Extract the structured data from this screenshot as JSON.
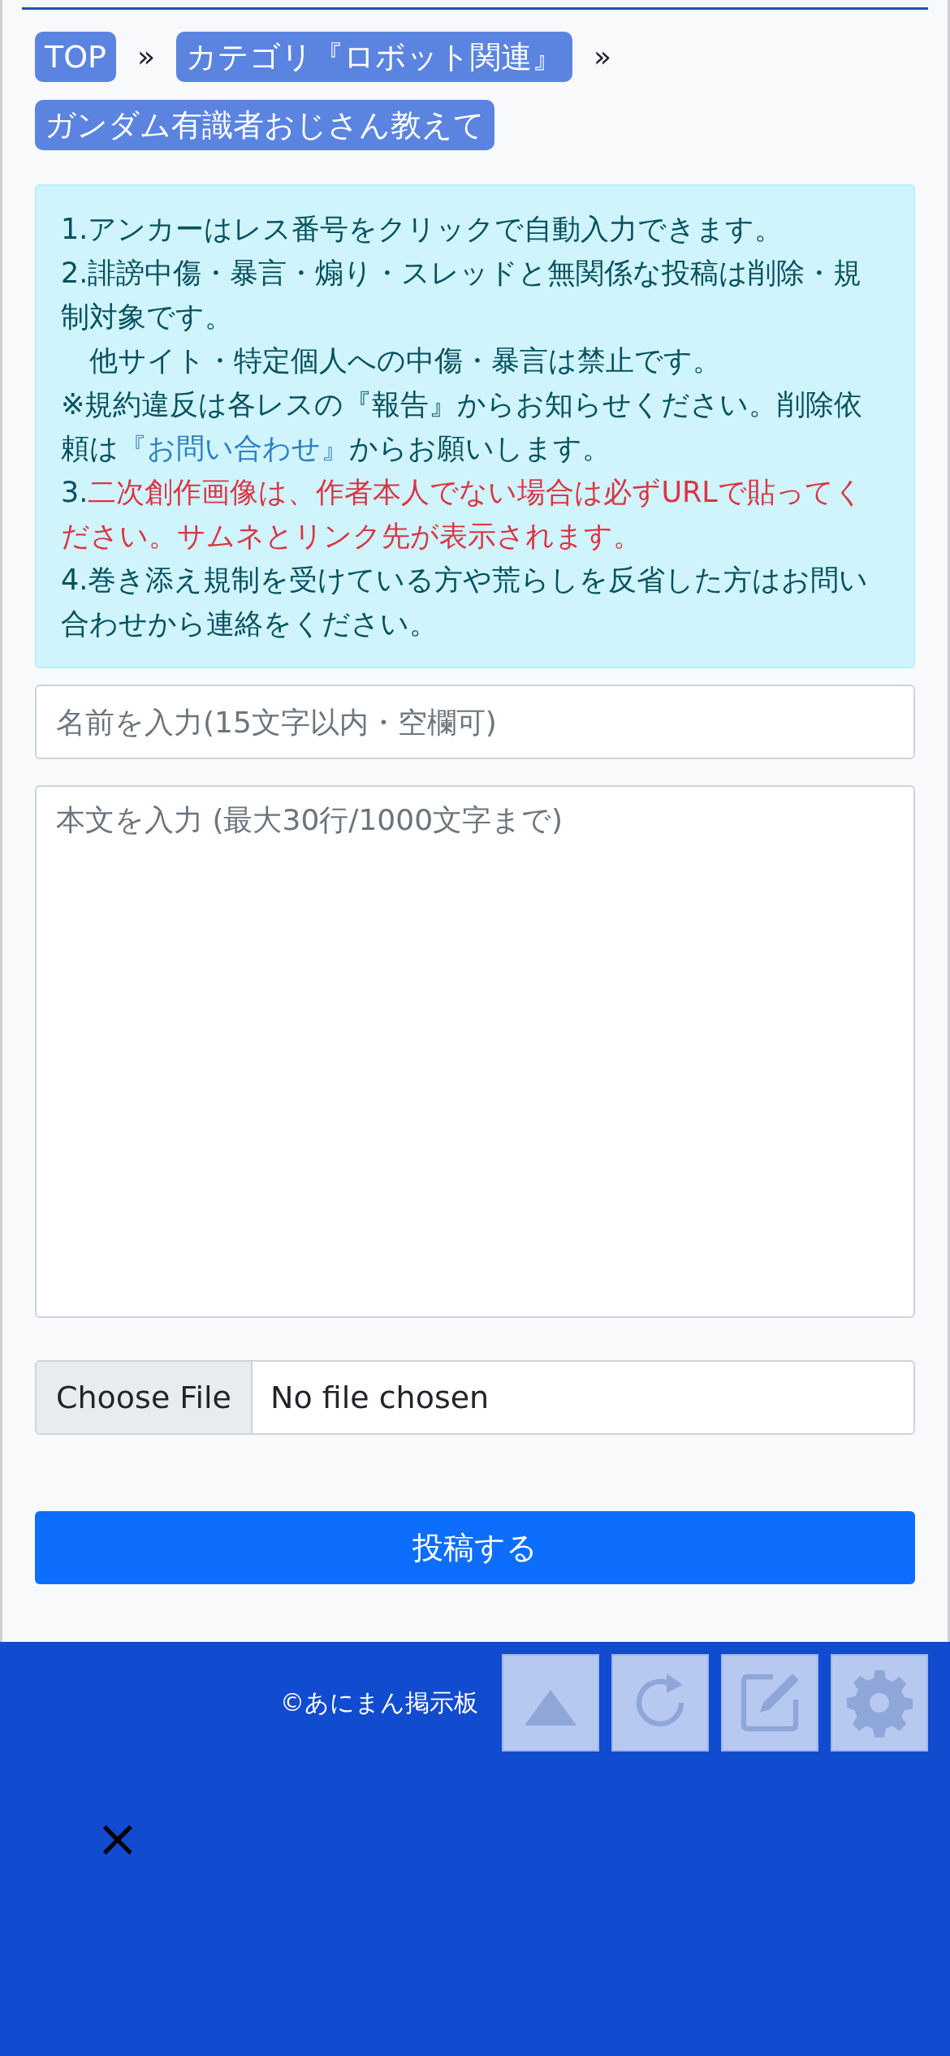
{
  "breadcrumbs": [
    {
      "label": "TOP",
      "separator": "»"
    },
    {
      "label": "カテゴリ『ロボット関連』",
      "separator": "»"
    },
    {
      "label": "ガンダム有識者おじさん教えて"
    }
  ],
  "notice": [
    {
      "segments": [
        {
          "kind": "plain",
          "text": "1.アンカーはレス番号をクリックで自動入力できます。"
        }
      ]
    },
    {
      "segments": [
        {
          "kind": "plain",
          "text": "2.誹謗中傷・暴言・煽り・スレッドと無関係な投稿は削除・規制対象です。"
        }
      ]
    },
    {
      "segments": [
        {
          "kind": "plain",
          "text": "　他サイト・特定個人への中傷・暴言は禁止です。"
        }
      ]
    },
    {
      "segments": [
        {
          "kind": "plain",
          "text": "※規約違反は各レスの『報告』からお知らせください。削除依頼は"
        },
        {
          "kind": "link",
          "text": "『お問い合わせ』"
        },
        {
          "kind": "plain",
          "text": "からお願いします。"
        }
      ]
    },
    {
      "segments": [
        {
          "kind": "plain",
          "text": "3."
        },
        {
          "kind": "alert",
          "text": "二次創作画像は、作者本人でない場合は必ずURLで貼ってください。サムネとリンク先が表示されます。"
        }
      ]
    },
    {
      "segments": [
        {
          "kind": "plain",
          "text": "4.巻き添え規制を受けている方や荒らしを反省した方はお問い合わせから連絡をください。"
        }
      ]
    }
  ],
  "form": {
    "name_field": {
      "placeholder": "名前を入力(15文字以内・空欄可)"
    },
    "body_field": {
      "placeholder": "本文を入力 (最大30行/1000文字まで)"
    },
    "file_input": {
      "button": "Choose File",
      "status": "No file chosen"
    },
    "submit_button": "投稿する"
  },
  "footer": {
    "copyright": "©あにまん掲示板",
    "tools": [
      {
        "kind": "up"
      },
      {
        "kind": "reload"
      },
      {
        "kind": "edit"
      },
      {
        "kind": "settings"
      }
    ],
    "close": "×"
  }
}
